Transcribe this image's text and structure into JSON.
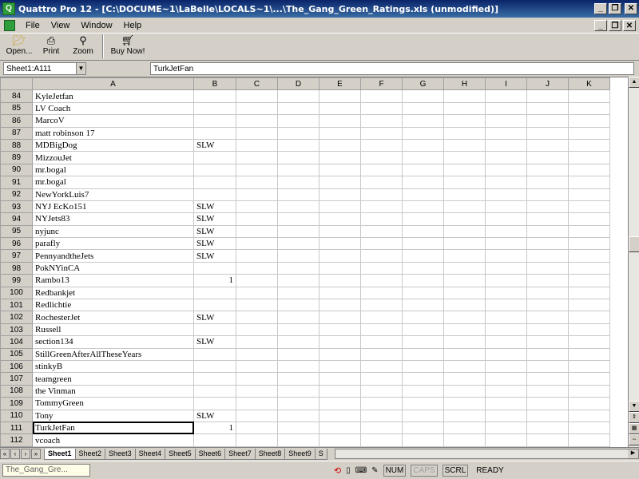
{
  "window": {
    "title": "Quattro Pro 12 - [C:\\DOCUME~1\\LaBelle\\LOCALS~1\\...\\The_Gang_Green_Ratings.xls (unmodified)]",
    "app_icon_glyph": "Q"
  },
  "menu": {
    "items": [
      {
        "label": "File"
      },
      {
        "label": "View"
      },
      {
        "label": "Window"
      },
      {
        "label": "Help"
      }
    ]
  },
  "toolbar": {
    "buttons": [
      {
        "label": "Open...",
        "icon": "folder-open-icon"
      },
      {
        "label": "Print",
        "icon": "printer-icon"
      },
      {
        "label": "Zoom",
        "icon": "magnifier-icon"
      },
      {
        "label": "Buy Now!",
        "icon": "cart-icon"
      }
    ]
  },
  "formula_bar": {
    "cell_ref": "Sheet1:A111",
    "content": "TurkJetFan"
  },
  "grid": {
    "columns": [
      "A",
      "B",
      "C",
      "D",
      "E",
      "F",
      "G",
      "H",
      "I",
      "J",
      "K"
    ],
    "rows": [
      {
        "n": "84",
        "a": "KyleJetfan",
        "b": ""
      },
      {
        "n": "85",
        "a": "LV Coach",
        "b": ""
      },
      {
        "n": "86",
        "a": "MarcoV",
        "b": ""
      },
      {
        "n": "87",
        "a": "matt robinson 17",
        "b": ""
      },
      {
        "n": "88",
        "a": "MDBigDog",
        "b": "SLW"
      },
      {
        "n": "89",
        "a": "MizzouJet",
        "b": ""
      },
      {
        "n": "90",
        "a": "mr.bogal",
        "b": ""
      },
      {
        "n": "91",
        "a": "mr.bogal",
        "b": ""
      },
      {
        "n": "92",
        "a": "NewYorkLuis7",
        "b": ""
      },
      {
        "n": "93",
        "a": "NYJ EcKo151",
        "b": "SLW"
      },
      {
        "n": "94",
        "a": "NYJets83",
        "b": "SLW"
      },
      {
        "n": "95",
        "a": "nyjunc",
        "b": "SLW"
      },
      {
        "n": "96",
        "a": "parafly",
        "b": "SLW"
      },
      {
        "n": "97",
        "a": "PennyandtheJets",
        "b": "SLW"
      },
      {
        "n": "98",
        "a": "PokNYinCA",
        "b": ""
      },
      {
        "n": "99",
        "a": "Rambo13",
        "b": "1"
      },
      {
        "n": "100",
        "a": "Redbankjet",
        "b": ""
      },
      {
        "n": "101",
        "a": "Redlichtie",
        "b": ""
      },
      {
        "n": "102",
        "a": "RochesterJet",
        "b": "SLW"
      },
      {
        "n": "103",
        "a": "Russell",
        "b": ""
      },
      {
        "n": "104",
        "a": "section134",
        "b": "SLW"
      },
      {
        "n": "105",
        "a": "StillGreenAfterAllTheseYears",
        "b": ""
      },
      {
        "n": "106",
        "a": "stinkyB",
        "b": ""
      },
      {
        "n": "107",
        "a": "teamgreen",
        "b": ""
      },
      {
        "n": "108",
        "a": "the Vinman",
        "b": ""
      },
      {
        "n": "109",
        "a": "TommyGreen",
        "b": ""
      },
      {
        "n": "110",
        "a": "Tony",
        "b": "SLW"
      },
      {
        "n": "111",
        "a": "TurkJetFan",
        "b": "1"
      },
      {
        "n": "112",
        "a": "vcoach",
        "b": ""
      }
    ],
    "active_row": "111"
  },
  "sheet_tabs": [
    "Sheet1",
    "Sheet2",
    "Sheet3",
    "Sheet4",
    "Sheet5",
    "Sheet6",
    "Sheet7",
    "Sheet8",
    "Sheet9",
    "S"
  ],
  "active_sheet": "Sheet1",
  "status": {
    "document": "The_Gang_Gre...",
    "indicators": [
      "NUM",
      "CAPS",
      "SCRL"
    ],
    "mode": "READY"
  }
}
